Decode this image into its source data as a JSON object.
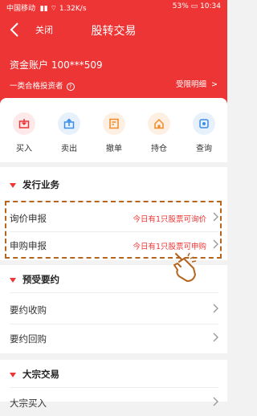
{
  "status_bar": {
    "carrier": "中国移动",
    "speed": "1.32K/s",
    "battery": "53%",
    "time": "10:34"
  },
  "nav": {
    "close_label": "关闭",
    "title": "股转交易"
  },
  "account": {
    "label": "资金账户 100***509",
    "investor_type": "一类合格投资者",
    "restriction_link": "受限明细"
  },
  "quick_actions": [
    {
      "label": "买入",
      "icon": "buy-icon"
    },
    {
      "label": "卖出",
      "icon": "sell-icon"
    },
    {
      "label": "撤单",
      "icon": "cancel-order-icon"
    },
    {
      "label": "持仓",
      "icon": "holdings-icon"
    },
    {
      "label": "查询",
      "icon": "query-icon"
    }
  ],
  "sections": {
    "issuance": {
      "title": "发行业务",
      "items": [
        {
          "label": "询价申报",
          "hint": "今日有1只股票可询价"
        },
        {
          "label": "申购申报",
          "hint": "今日有1只股票可申购"
        }
      ]
    },
    "tender": {
      "title": "预受要约",
      "items": [
        {
          "label": "要约收购"
        },
        {
          "label": "要约回购"
        }
      ]
    },
    "block_trade": {
      "title": "大宗交易",
      "items": [
        {
          "label": "大宗买入"
        }
      ]
    }
  },
  "colors": {
    "brand_red": "#ee3535",
    "highlight_border": "#b5651d"
  }
}
